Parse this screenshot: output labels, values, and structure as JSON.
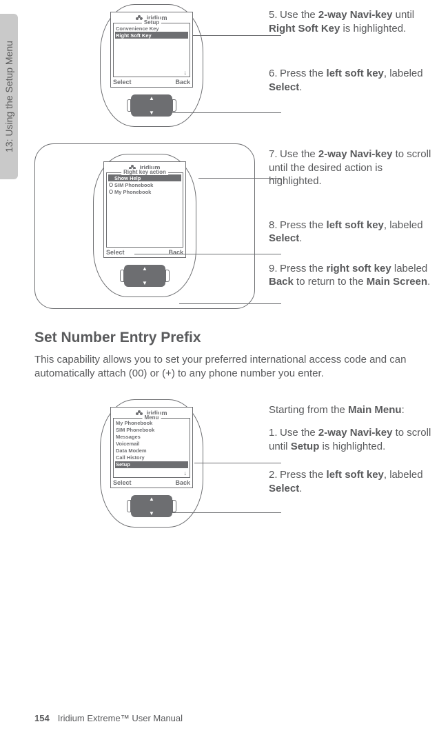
{
  "sidetab": "13: Using the Setup Menu",
  "brand": "iridium",
  "phone1": {
    "fieldsetTitle": "Setup",
    "items": [
      "Convenience Key",
      "Right Soft Key"
    ],
    "highlightIndex": 1,
    "leftSoft": "Select",
    "rightSoft": "Back"
  },
  "phone2": {
    "fieldsetTitle": "Right key action",
    "radios": [
      {
        "label": "Show Help",
        "selected": true,
        "highlighted": true
      },
      {
        "label": "SIM Phonebook",
        "selected": false,
        "highlighted": false
      },
      {
        "label": "My Phonebook",
        "selected": false,
        "highlighted": false
      }
    ],
    "leftSoft": "Select",
    "rightSoft": "Back"
  },
  "phone3": {
    "fieldsetTitle": "Menu",
    "items": [
      "My Phonebook",
      "SIM Phonebook",
      "Messages",
      "Voicemail",
      "Data Modem",
      "Call History",
      "Setup"
    ],
    "highlightIndex": 6,
    "leftSoft": "Select",
    "rightSoft": "Back"
  },
  "steps": {
    "s5": {
      "n": "5.",
      "pre": "Use the ",
      "b1": "2-way Navi-key",
      "mid": " until ",
      "b2": "Right Soft Key",
      "post": " is highlighted."
    },
    "s6": {
      "n": "6.",
      "pre": "Press the ",
      "b1": "left soft key",
      "mid": ", labeled ",
      "b2": "Select",
      "post": "."
    },
    "s7": {
      "n": "7.",
      "pre": "Use the ",
      "b1": "2-way Navi-key",
      "mid": " to scroll until the desired action is highlighted.",
      "b2": "",
      "post": ""
    },
    "s8": {
      "n": "8.",
      "pre": "Press the ",
      "b1": "left soft key",
      "mid": ", labeled ",
      "b2": "Select",
      "post": "."
    },
    "s9": {
      "n": "9.",
      "pre": "Press the ",
      "b1": "right soft key",
      "mid": " labeled ",
      "b2": "Back",
      "post2a": " to return to the ",
      "b3": "Main Screen",
      "post2b": "."
    },
    "intro3": {
      "pre": "Starting from the ",
      "b1": "Main Menu",
      "post": ":"
    },
    "s1": {
      "n": "1.",
      "pre": "Use the ",
      "b1": "2-way Navi-key",
      "mid": " to scroll until ",
      "b2": "Setup",
      "post": " is highlighted."
    },
    "s2": {
      "n": "2.",
      "pre": "Press the ",
      "b1": "left soft key",
      "mid": ", labeled ",
      "b2": "Select",
      "post": "."
    }
  },
  "section": {
    "title": "Set Number Entry Prefix",
    "body": "This capability allows you to set your preferred international access code and can automatically attach (00) or (+) to any phone number you enter."
  },
  "footer": {
    "page": "154",
    "title": "Iridium Extreme™ User Manual"
  }
}
